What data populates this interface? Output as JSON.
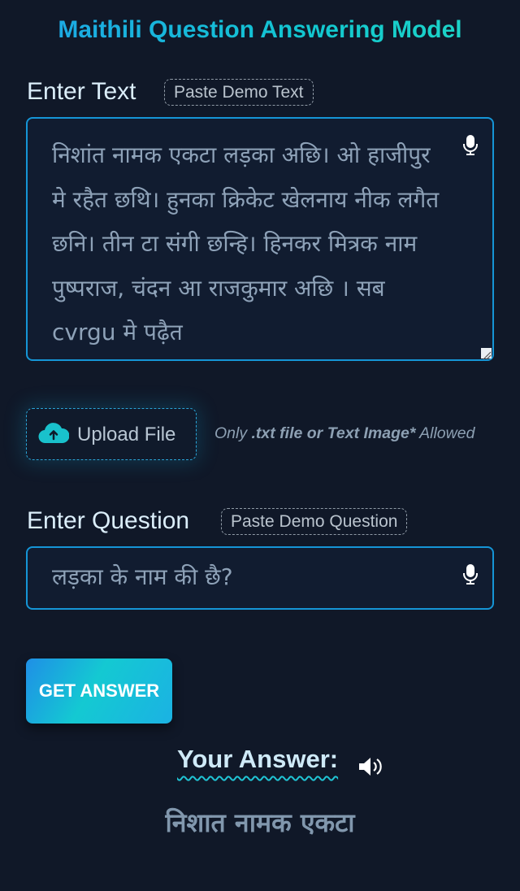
{
  "app": {
    "title": "Maithili Question Answering Model"
  },
  "text_section": {
    "label": "Enter Text",
    "demo_button": "Paste Demo Text",
    "textarea_value": "निशांत नामक एकटा लड़का अछि। ओ हाजीपुर मे रहैत छथि। हुनका क्रिकेट खेलनाय नीक लगैत छनि। तीन टा संगी छन्हि। हिनकर मित्रक नाम पुष्पराज, चंदन आ राजकुमार अछि । सब cvrgu मे पढ़ैत",
    "mic_icon": "microphone-icon"
  },
  "upload": {
    "button_label": "Upload File",
    "icon": "cloud-upload-icon",
    "note_prefix": "Only ",
    "note_bold": ".txt file or Text Image*",
    "note_suffix": " Allowed"
  },
  "question_section": {
    "label": "Enter Question",
    "demo_button": "Paste Demo Question",
    "input_value": "लड़का के नाम की छै?",
    "mic_icon": "microphone-icon"
  },
  "actions": {
    "get_answer_label": "GET ANSWER"
  },
  "answer": {
    "heading": "Your Answer:",
    "speaker_icon": "speaker-volume-icon",
    "value": "निशात नामक एकटा"
  },
  "colors": {
    "background": "#101828",
    "accent": "#1595d6",
    "title_gradient_start": "#1ea4e8",
    "title_gradient_end": "#20d8c4"
  }
}
